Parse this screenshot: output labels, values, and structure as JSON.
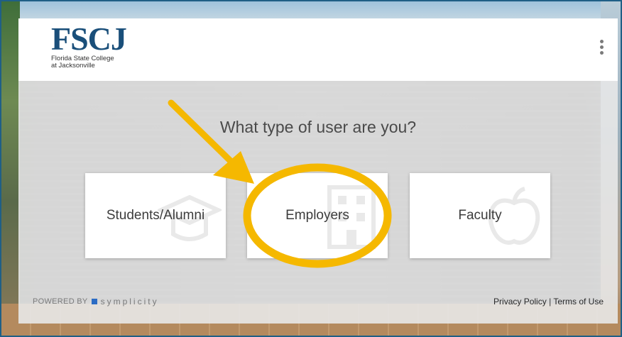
{
  "logo": {
    "mark": "FSCJ",
    "line1": "Florida State College",
    "line2": "at Jacksonville"
  },
  "header": {
    "menu_icon": "kebab-menu-icon"
  },
  "prompt": {
    "question": "What type of user are you?"
  },
  "user_types": [
    {
      "label": "Students/Alumni",
      "icon": "graduation-cap-icon"
    },
    {
      "label": "Employers",
      "icon": "building-icon"
    },
    {
      "label": "Faculty",
      "icon": "apple-icon"
    }
  ],
  "footer": {
    "powered_by": "POWERED BY",
    "brand": "symplicity",
    "privacy": "Privacy Policy",
    "separator": "|",
    "terms": "Terms of Use"
  },
  "annotation": {
    "arrow_color": "#F5B800",
    "highlight_target": "Employers"
  },
  "colors": {
    "brand_blue": "#1a4f7a",
    "frame_border": "#1f5f86",
    "symplicity_blue": "#2b6cc4"
  }
}
